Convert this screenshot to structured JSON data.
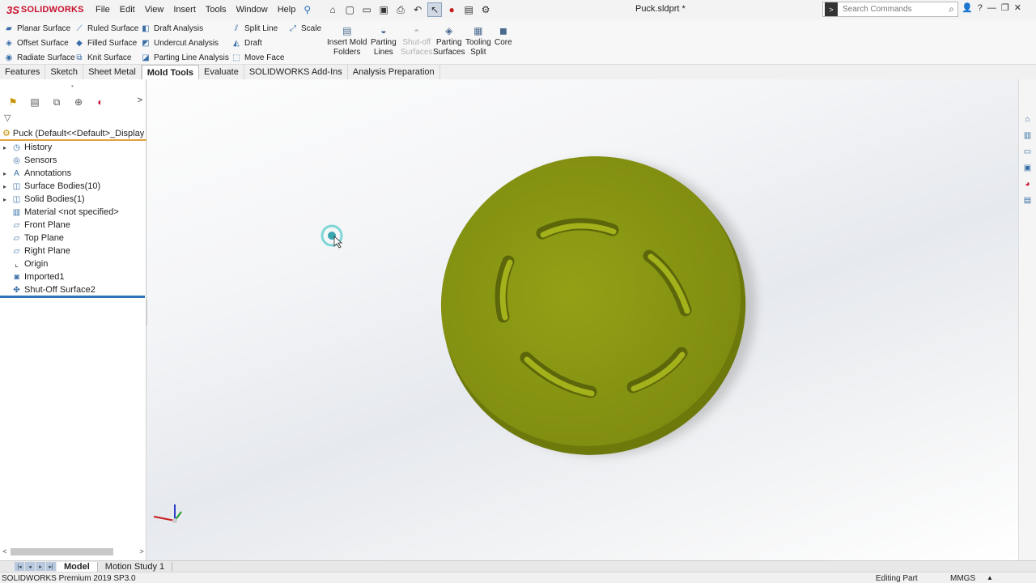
{
  "app": {
    "logo_prefix": "3S",
    "logo_name": "SOLIDWORKS",
    "menus": [
      "File",
      "Edit",
      "View",
      "Insert",
      "Tools",
      "Window",
      "Help"
    ],
    "document_title": "Puck.sldprt *",
    "search_placeholder": "Search Commands",
    "help_label": "?"
  },
  "ribbon": {
    "col1": [
      "Planar Surface",
      "Offset Surface",
      "Radiate Surface"
    ],
    "col2": [
      "Ruled Surface",
      "Filled Surface",
      "Knit Surface"
    ],
    "col3": [
      "Draft Analysis",
      "Undercut Analysis",
      "Parting Line Analysis"
    ],
    "col4": [
      "Split Line",
      "Draft",
      "Move Face"
    ],
    "col5": [
      "Scale"
    ],
    "big": [
      {
        "line1": "Insert Mold",
        "line2": "Folders",
        "enabled": true
      },
      {
        "line1": "Parting",
        "line2": "Lines",
        "enabled": true
      },
      {
        "line1": "Shut-off",
        "line2": "Surfaces",
        "enabled": false
      },
      {
        "line1": "Parting",
        "line2": "Surfaces",
        "enabled": true
      },
      {
        "line1": "Tooling",
        "line2": "Split",
        "enabled": true
      },
      {
        "line1": "Core",
        "line2": "",
        "enabled": true
      }
    ]
  },
  "tabs": [
    "Features",
    "Sketch",
    "Sheet Metal",
    "Mold Tools",
    "Evaluate",
    "SOLIDWORKS Add-Ins",
    "Analysis Preparation"
  ],
  "active_tab": "Mold Tools",
  "feature_tree": {
    "root": "Puck  (Default<<Default>_Display St",
    "items": [
      {
        "label": "History",
        "expandable": true
      },
      {
        "label": "Sensors",
        "expandable": false
      },
      {
        "label": "Annotations",
        "expandable": true
      },
      {
        "label": "Surface Bodies(10)",
        "expandable": true
      },
      {
        "label": "Solid Bodies(1)",
        "expandable": true
      },
      {
        "label": "Material <not specified>",
        "expandable": false
      },
      {
        "label": "Front Plane",
        "expandable": false
      },
      {
        "label": "Top Plane",
        "expandable": false
      },
      {
        "label": "Right Plane",
        "expandable": false
      },
      {
        "label": "Origin",
        "expandable": false
      },
      {
        "label": "Imported1",
        "expandable": false
      },
      {
        "label": "Shut-Off Surface2",
        "expandable": false
      }
    ]
  },
  "bottom_tabs": [
    "Model",
    "Motion Study 1"
  ],
  "status": {
    "product": "SOLIDWORKS Premium 2019 SP3.0",
    "mode": "Editing Part",
    "units": "MMGS"
  },
  "colors": {
    "part": "#8c9a12",
    "part_side": "#6f7a0c",
    "accent": "#2e72b8",
    "root_underline": "#e2a23a"
  }
}
